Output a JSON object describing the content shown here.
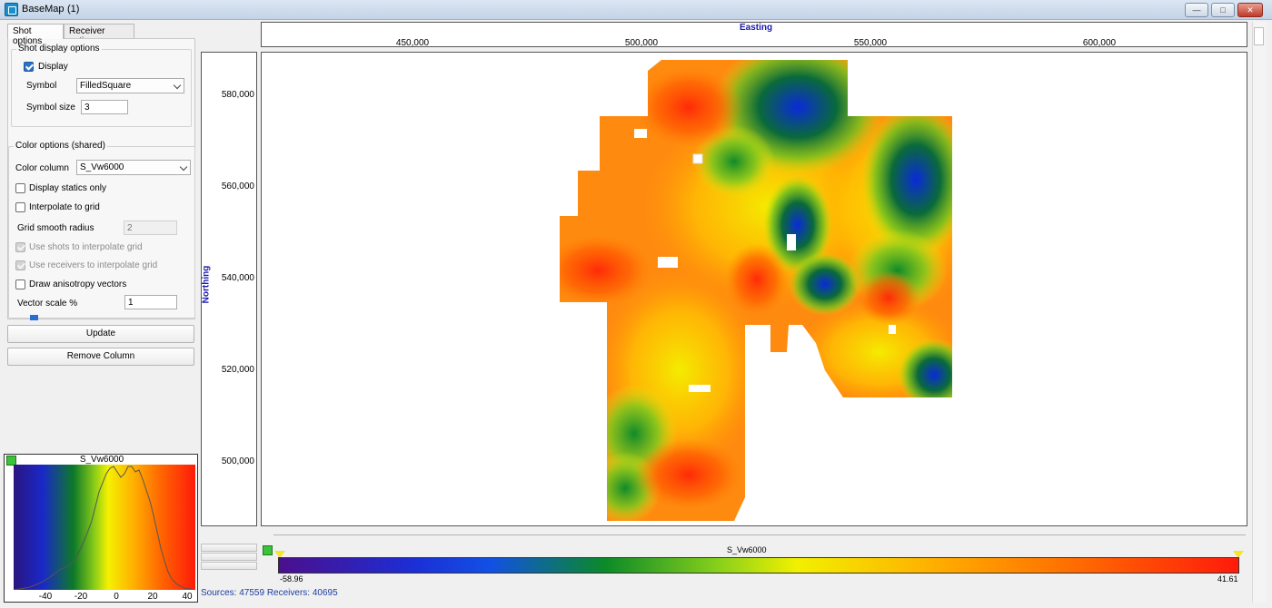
{
  "window": {
    "title": "BaseMap",
    "count": "(1)",
    "buttons": {
      "minimize": "—",
      "restore": "□",
      "close": "✕"
    }
  },
  "tabs": [
    {
      "label": "Shot options",
      "active": true
    },
    {
      "label": "Receiver options",
      "active": false
    }
  ],
  "shot_display": {
    "group_title": "Shot display options",
    "display_label": "Display",
    "display_checked": true,
    "symbol_label": "Symbol",
    "symbol_value": "FilledSquare",
    "symbol_size_label": "Symbol size",
    "symbol_size_value": "3"
  },
  "color_options": {
    "group_title": "Color options (shared)",
    "color_column_label": "Color column",
    "color_column_value": "S_Vw6000",
    "display_statics_label": "Display statics only",
    "interpolate_label": "Interpolate to grid",
    "grid_smooth_label": "Grid smooth radius",
    "grid_smooth_value": "2",
    "use_shots_label": "Use shots to interpolate grid",
    "use_receivers_label": "Use receivers to interpolate grid",
    "anisotropy_label": "Draw anisotropy vectors",
    "vector_scale_label": "Vector scale %",
    "vector_scale_value": "1"
  },
  "buttons": {
    "update": "Update",
    "remove_column": "Remove Column"
  },
  "histogram": {
    "title": "S_Vw6000",
    "ticks": [
      "-40",
      "-20",
      "0",
      "20",
      "40"
    ]
  },
  "map": {
    "x_title": "Easting",
    "x_ticks": [
      "450,000",
      "500,000",
      "550,000",
      "600,000"
    ],
    "y_title": "Northing",
    "y_ticks": [
      "580,000",
      "560,000",
      "540,000",
      "520,000",
      "500,000"
    ]
  },
  "legend": {
    "title": "S_Vw6000",
    "min": "-58.96",
    "max": "41.61"
  },
  "status": {
    "text": "Sources: 47559   Receivers: 40695"
  }
}
